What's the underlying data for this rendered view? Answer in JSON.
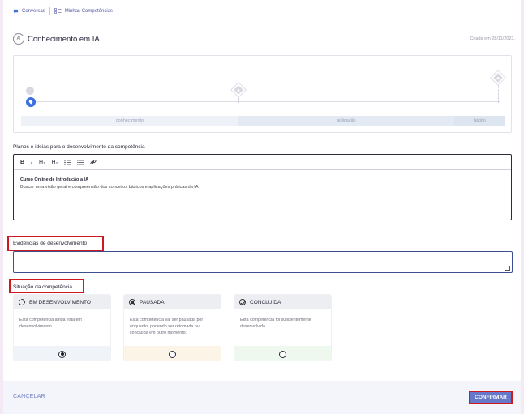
{
  "breadcrumb": {
    "items": [
      {
        "label": "Conversas",
        "icon": "chat-icon"
      },
      {
        "label": "Minhas Competências",
        "icon": "checklist-icon"
      }
    ]
  },
  "header": {
    "icon": "ai-icon",
    "icon_text": "AI",
    "title": "Conhecimento em IA",
    "created": "Criada em 28/11/2023."
  },
  "progress": {
    "current_stage": "conhecimento",
    "stages": [
      "conhecimento",
      "aplicação",
      "hábito"
    ]
  },
  "plans": {
    "label": "Planos e ideias para o desenvolvimento da competência",
    "toolbar": [
      "B",
      "I",
      "H₁",
      "H₂",
      "bulleted-list-icon",
      "numbered-list-icon",
      "link-icon"
    ],
    "content_title": "Curso Online de Introdução a IA",
    "content_text": "Buscar uma visão geral e compreensão dos conceitos básicos e aplicações práticas da IA"
  },
  "evidence": {
    "label": "Evidências de desenvolvimento",
    "value": ""
  },
  "status": {
    "label": "Situação da competência",
    "options": [
      {
        "title": "EM DESENVOLVIMENTO",
        "icon": "in-progress-icon",
        "description": "Esta competência ainda está em desenvolvimento.",
        "selected": true,
        "bg": "#f0f3f8"
      },
      {
        "title": "PAUSADA",
        "icon": "pause-icon",
        "description": "Esta competência vai ser pausada por enquanto, podendo ser retomada ou concluída em outro momento.",
        "selected": false,
        "bg": "#fdf4e8"
      },
      {
        "title": "CONCLUÍDA",
        "icon": "check-circle-icon",
        "description": "Esta competência foi suficientemente desenvolvida.",
        "selected": false,
        "bg": "#eef8ee"
      }
    ]
  },
  "footer": {
    "cancel_label": "CANCELAR",
    "confirm_label": "CONFIRMAR"
  },
  "colors": {
    "accent": "#6878c9",
    "highlight_border": "#d0191d"
  }
}
